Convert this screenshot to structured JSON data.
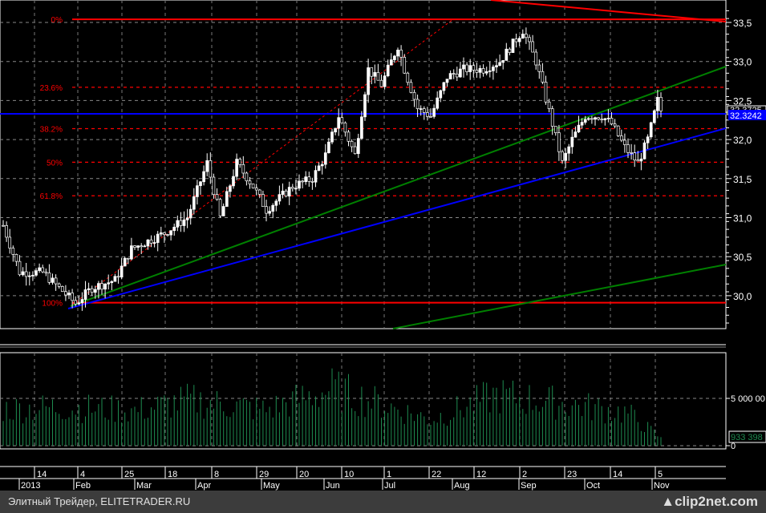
{
  "chart_data": {
    "type": "candlestick",
    "price_axis": {
      "min": 29.6,
      "max": 33.75,
      "ticks": [
        "33,5",
        "33,0",
        "32,5",
        "32,0",
        "31,5",
        "31,0",
        "30,5",
        "30,0"
      ],
      "tick_values": [
        33.5,
        33.0,
        32.5,
        32.0,
        31.5,
        31.0,
        30.5,
        30.0
      ]
    },
    "last_price_label": "32.3725",
    "cursor_price_label": "32.3242",
    "fibonacci": [
      {
        "label": "0%",
        "price": 33.54
      },
      {
        "label": "23.6%",
        "price": 32.67
      },
      {
        "label": "38.2%",
        "price": 32.14
      },
      {
        "label": "50%",
        "price": 31.71
      },
      {
        "label": "61.8%",
        "price": 31.28
      },
      {
        "label": "100%",
        "price": 29.91
      }
    ],
    "price_keypoints": [
      [
        0,
        30.9
      ],
      [
        5,
        30.3
      ],
      [
        12,
        30.3
      ],
      [
        22,
        29.9
      ],
      [
        27,
        30.1
      ],
      [
        34,
        30.2
      ],
      [
        39,
        30.6
      ],
      [
        49,
        30.8
      ],
      [
        56,
        31.0
      ],
      [
        62,
        31.7
      ],
      [
        66,
        31.0
      ],
      [
        71,
        31.7
      ],
      [
        76,
        31.4
      ],
      [
        80,
        31.1
      ],
      [
        88,
        31.4
      ],
      [
        94,
        31.5
      ],
      [
        98,
        31.8
      ],
      [
        102,
        32.3
      ],
      [
        107,
        31.8
      ],
      [
        111,
        32.9
      ],
      [
        115,
        32.7
      ],
      [
        120,
        33.2
      ],
      [
        122,
        32.9
      ],
      [
        126,
        32.4
      ],
      [
        130,
        32.3
      ],
      [
        135,
        32.8
      ],
      [
        140,
        32.9
      ],
      [
        146,
        32.9
      ],
      [
        151,
        33.0
      ],
      [
        158,
        33.4
      ],
      [
        162,
        33.0
      ],
      [
        167,
        32.2
      ],
      [
        170,
        31.7
      ],
      [
        173,
        32.0
      ],
      [
        177,
        32.3
      ],
      [
        182,
        32.3
      ],
      [
        185,
        32.2
      ],
      [
        189,
        31.9
      ],
      [
        193,
        31.7
      ],
      [
        196,
        32.0
      ],
      [
        199,
        32.5
      ],
      [
        200,
        32.37
      ]
    ],
    "volume_axis": {
      "ticks": [
        "5 000 00",
        "0"
      ],
      "tick_values": [
        5000000,
        0
      ]
    },
    "last_volume_label": "933 398",
    "volume_keypoints_millions": [
      [
        0,
        4.2
      ],
      [
        20,
        4.4
      ],
      [
        40,
        4.0
      ],
      [
        57,
        5.2
      ],
      [
        80,
        4.1
      ],
      [
        100,
        6.5
      ],
      [
        130,
        3.0
      ],
      [
        150,
        5.8
      ],
      [
        175,
        4.6
      ],
      [
        190,
        3.7
      ],
      [
        200,
        0.9
      ]
    ],
    "x_day_ticks": [
      "14",
      "4",
      "25",
      "18",
      "8",
      "29",
      "20",
      "10",
      "1",
      "22",
      "12",
      "2",
      "23",
      "14",
      "5"
    ],
    "x_month_labels": [
      "2013",
      "Feb",
      "Mar",
      "Apr",
      "May",
      "Jun",
      "Jul",
      "Aug",
      "Sep",
      "Oct",
      "Nov"
    ]
  },
  "footer": {
    "source": "Элитный Трейдер, ELITETRADER.RU",
    "logo": "clip2net.com"
  },
  "colors": {
    "support": "#0000ff",
    "trend": "#008000",
    "fib": "#ff0000",
    "volume": "#1e8c50"
  }
}
